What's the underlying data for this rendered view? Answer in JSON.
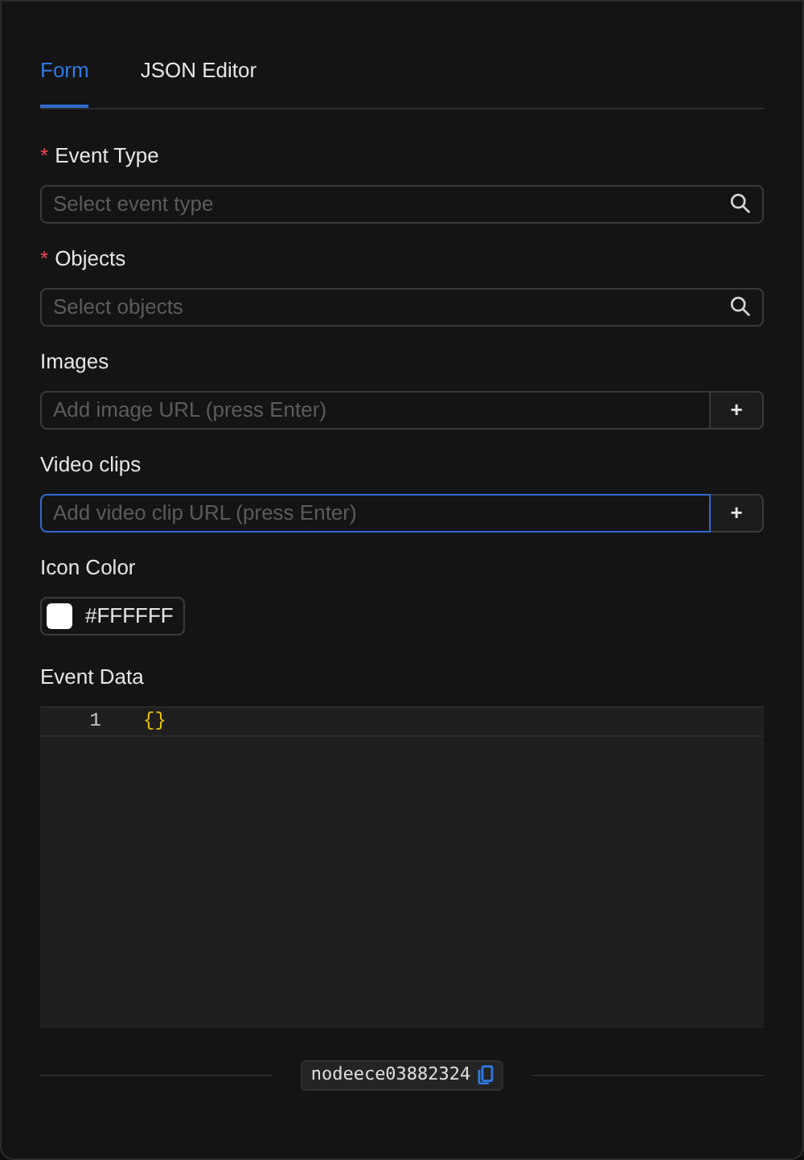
{
  "tabs": [
    {
      "label": "Form",
      "selected": true
    },
    {
      "label": "JSON Editor",
      "selected": false
    }
  ],
  "fields": [
    {
      "kind": "search",
      "label": "Event Type",
      "required_mark": "*",
      "placeholder": "Select event type",
      "focused": false
    },
    {
      "kind": "search",
      "label": "Objects",
      "required_mark": "*",
      "placeholder": "Select objects",
      "focused": false
    },
    {
      "kind": "add",
      "label": "Images",
      "placeholder": "Add image URL (press Enter)",
      "focused": false,
      "button": "+"
    },
    {
      "kind": "add",
      "label": "Video clips",
      "placeholder": "Add video clip URL (press Enter)",
      "focused": true,
      "button": "+"
    },
    {
      "kind": "color",
      "label": "Icon Color",
      "color": "#ffffff",
      "value": "#FFFFFF"
    }
  ],
  "editor": {
    "label": "Event Data",
    "lines": [
      {
        "number": "1",
        "code": "{}"
      }
    ]
  },
  "footer": {
    "node_id": "nodeece03882324"
  }
}
